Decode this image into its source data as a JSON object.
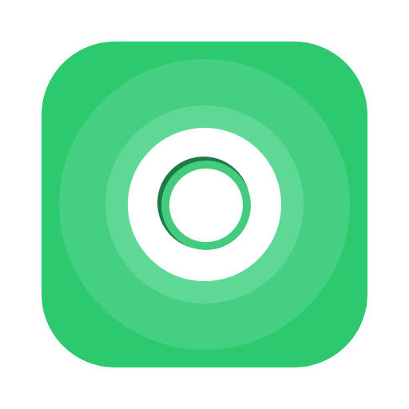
{
  "app_icon": {
    "icon": "concentric-rings-icon",
    "colors": {
      "tile": "#2cc96f",
      "halo_outer": "#45cf82",
      "halo_inner": "#5fd896",
      "ring": "#ffffff",
      "ring_band": "#43cc7e",
      "ring_band_edge": "#1f7a47",
      "center": "#ffffff"
    }
  }
}
